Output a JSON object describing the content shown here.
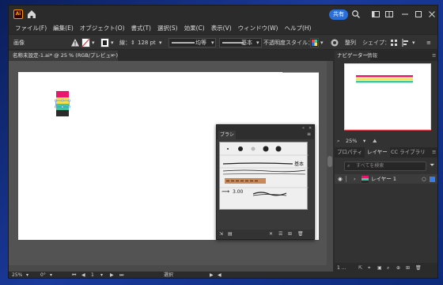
{
  "app": {
    "logo_text": "Ai",
    "accent": "#ff9a00"
  },
  "titlebar": {
    "share_label": "共有",
    "icons": [
      "home-icon",
      "search-icon",
      "arrange-icon",
      "panel-icon",
      "minimize-icon",
      "maximize-icon",
      "close-icon"
    ]
  },
  "menu": [
    "ファイル(F)",
    "編集(E)",
    "オブジェクト(O)",
    "書式(T)",
    "選択(S)",
    "効果(C)",
    "表示(V)",
    "ウィンドウ(W)",
    "ヘルプ(H)"
  ],
  "controlbar": {
    "group_label": "画像",
    "stroke_label": "線：",
    "stroke_value": "128 pt",
    "brush_label": "均等",
    "profile_label": "基本",
    "opacity_label": "不透明度",
    "style_label": "スタイル：",
    "arrange_label": "整列",
    "shape_label": "シェイプ："
  },
  "document": {
    "tab_title": "名称未設定-1.ai* @ 25 % (RGB/プレビュー)"
  },
  "artwork": {
    "colors": [
      "#e8176d",
      "#f7e04a",
      "#3fc7a0",
      "#2b2b2b"
    ]
  },
  "brush_panel": {
    "tab_label": "ブラシ",
    "basic_label": "基本",
    "stroke_width": "3.00"
  },
  "navigator": {
    "tab_navigator": "ナビゲーター",
    "tab_info": "情報",
    "zoom_value": "25%",
    "preview_colors": [
      "#e8176d",
      "#f7e04a",
      "#3fc7a0"
    ]
  },
  "layers_panel": {
    "tab_properties": "プロパティ",
    "tab_layers": "レイヤー",
    "tab_libraries": "CC ライブラリ",
    "search_placeholder": "すべてを検索",
    "layer_name": "レイヤー 1",
    "footer_count": "1 ..."
  },
  "statusbar": {
    "zoom": "25%",
    "rotation": "0°",
    "artboard_num": "1",
    "tool": "選択"
  }
}
